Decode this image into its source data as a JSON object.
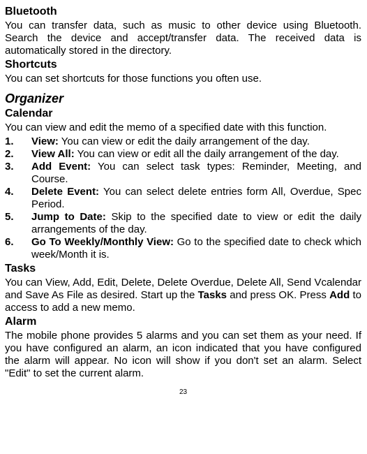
{
  "sections": {
    "bluetooth": {
      "heading": "Bluetooth",
      "body": "You can transfer data, such as music to other device using Bluetooth. Search the device and accept/transfer data. The received data is automatically stored in the directory."
    },
    "shortcuts": {
      "heading": "Shortcuts",
      "body": "You can set shortcuts for those functions you often use."
    },
    "organizer": {
      "heading": "Organizer"
    },
    "calendar": {
      "heading": "Calendar",
      "intro": "You can view and edit the memo of a specified date with this function.",
      "items": [
        {
          "num": "1.",
          "title": "View:",
          "desc": " You can view or edit the daily arrangement of the day."
        },
        {
          "num": "2.",
          "title": "View All:",
          "desc": " You can view or edit all the daily arrangement of the day."
        },
        {
          "num": "3.",
          "title": "Add Event:",
          "desc": " You can select task types: Reminder, Meeting, and Course."
        },
        {
          "num": "4.",
          "title": "Delete Event:",
          "desc": " You can select delete entries form All, Overdue, Spec Period."
        },
        {
          "num": "5.",
          "title": "Jump to Date:",
          "desc": " Skip to the specified date to view or edit the daily arrangements of the day."
        },
        {
          "num": "6.",
          "title": "Go To Weekly/Monthly View:",
          "desc": " Go to the specified date to check which week/Month it is."
        }
      ]
    },
    "tasks": {
      "heading": "Tasks",
      "part1": "You can View, Add, Edit, Delete, Delete Overdue, Delete All, Send Vcalendar and Save As File as desired. Start up the ",
      "bold1": "Tasks",
      "part2": " and press OK. Press ",
      "bold2": "Add",
      "part3": " to access to add a new memo."
    },
    "alarm": {
      "heading": "Alarm",
      "body": "The mobile phone provides 5 alarms and you can set them as your need. If you have configured an alarm, an icon indicated that you have configured the alarm will appear. No icon will show if you don't set an alarm. Select \"Edit\" to set the current alarm."
    }
  },
  "page_number": "23"
}
